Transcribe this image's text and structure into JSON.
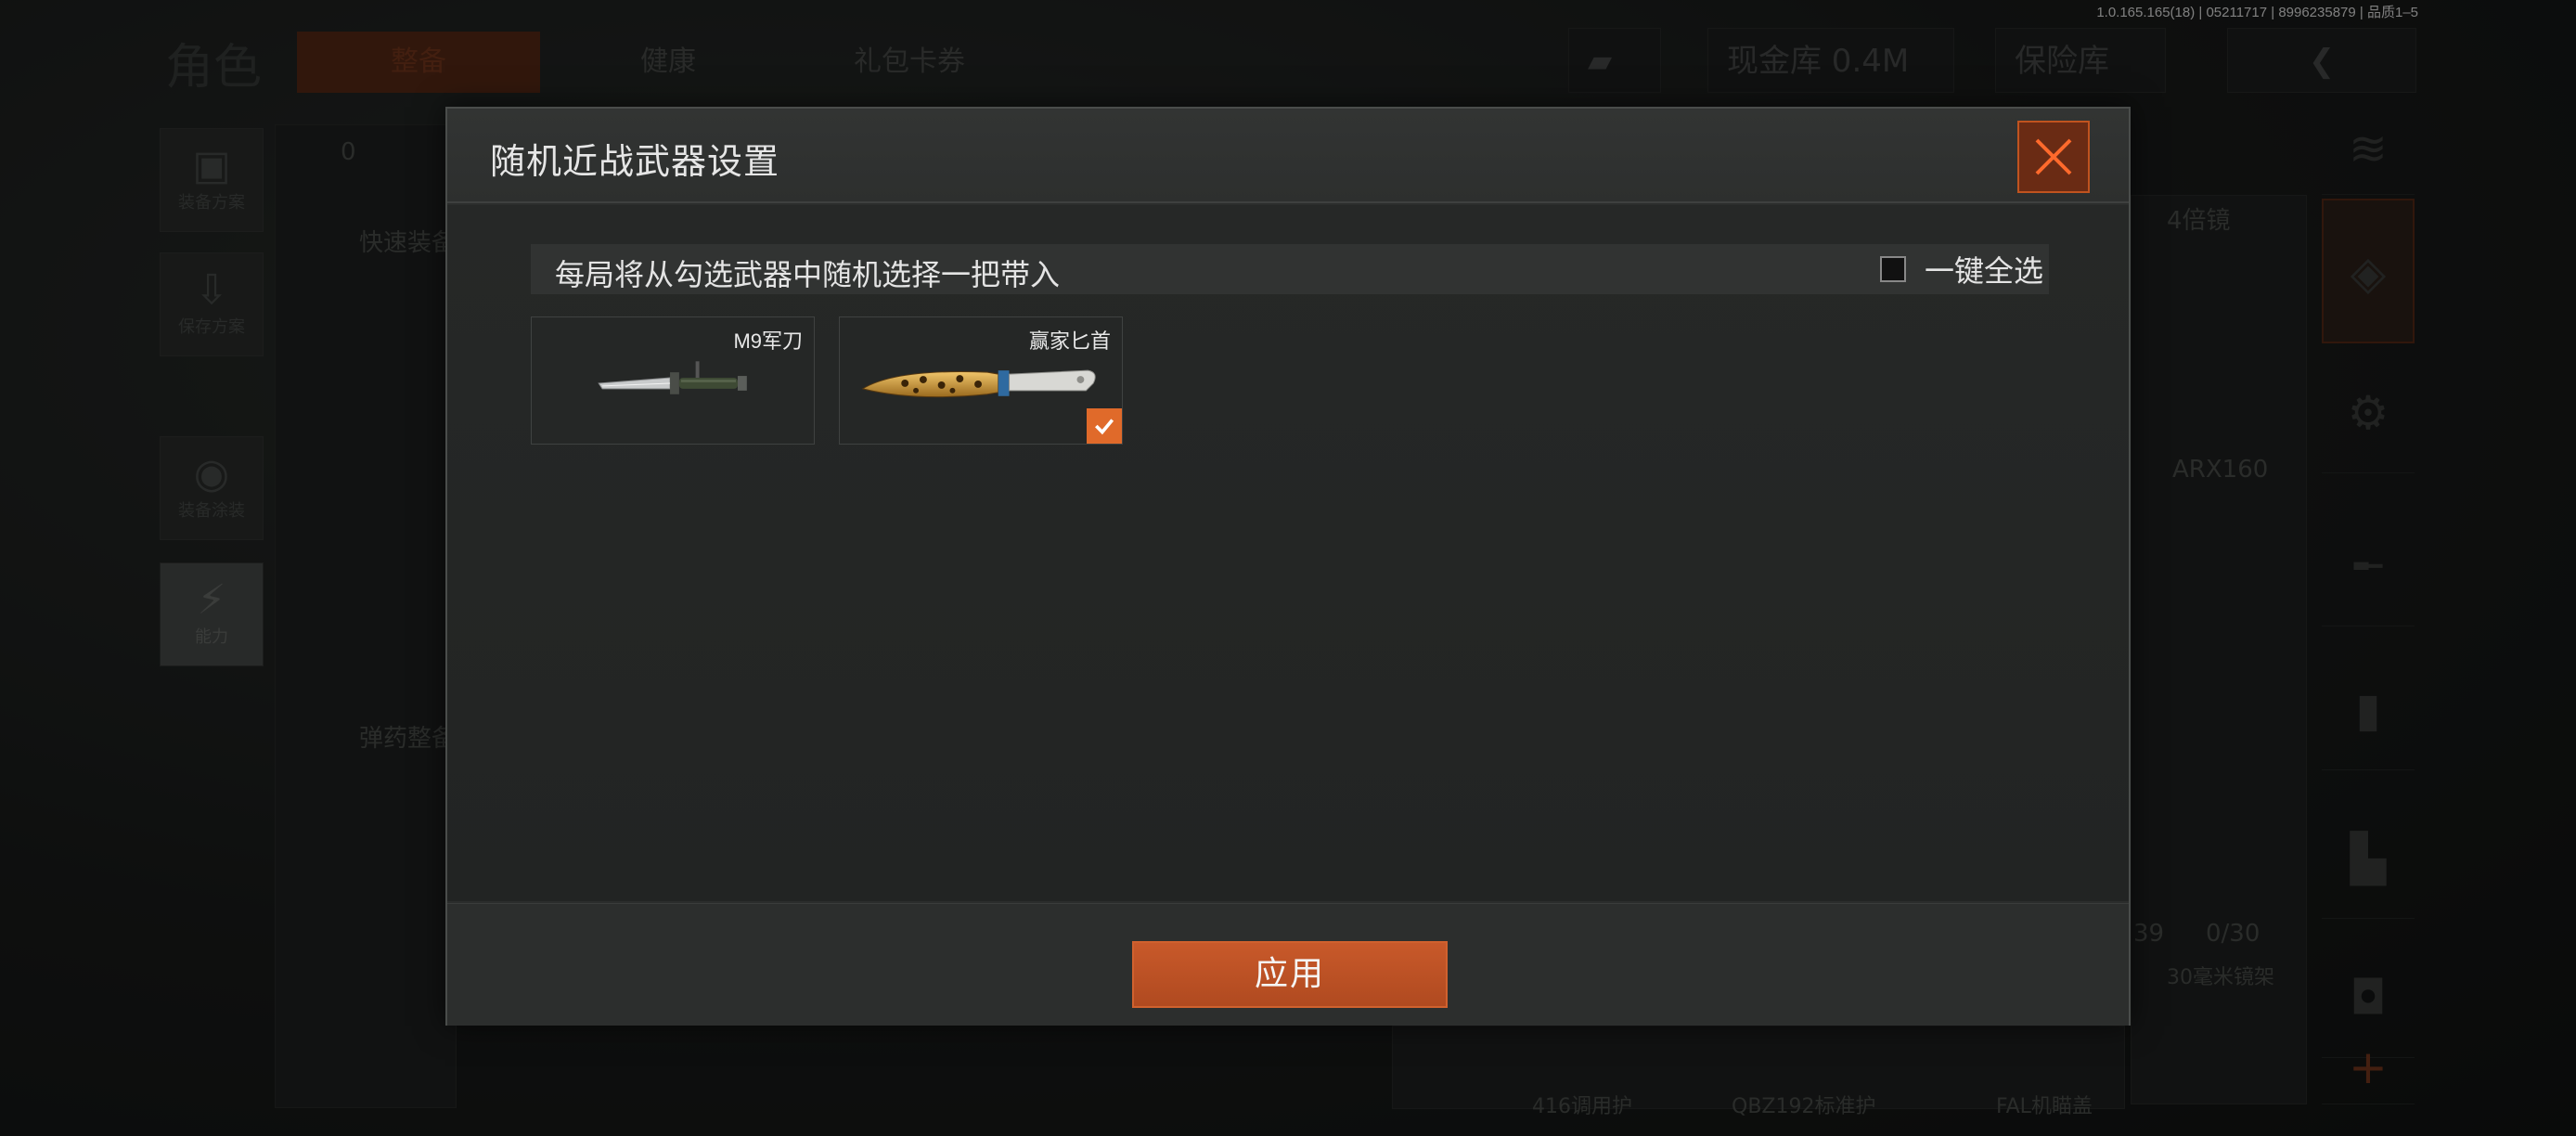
{
  "version_text": "1.0.165.165(18) | 05211717 | 8996235879 | 品质1–5",
  "background": {
    "role_title": "角色",
    "tabs": [
      "整备",
      "健康",
      "礼包卡券"
    ],
    "money_count": "0",
    "cash_vault": "现金库 0.4M",
    "safe_box": "保险库",
    "rail_items": [
      "装备方案",
      "保存方案",
      "装备涂装",
      "能力"
    ],
    "left_panel_texts": [
      "0",
      "快速装备",
      "弹药整备"
    ],
    "right_panel_texts": [
      "4倍镜",
      "ARX160",
      "39",
      "0/30",
      "30毫米镜架",
      "416调用护",
      "QBZ192标准护",
      "FAL机瞄盖"
    ]
  },
  "modal": {
    "title": "随机近战武器设置",
    "info_text": "每局将从勾选武器中随机选择一把带入",
    "select_all_label": "一键全选",
    "select_all_checked": false,
    "weapons": [
      {
        "name": "M9军刀",
        "checked": false
      },
      {
        "name": "赢家匕首",
        "checked": true
      }
    ],
    "apply_label": "应用"
  },
  "colors": {
    "accent": "#e06a2a",
    "modal_bg": "#2b2d2c",
    "close_bg": "#6a2b14"
  }
}
